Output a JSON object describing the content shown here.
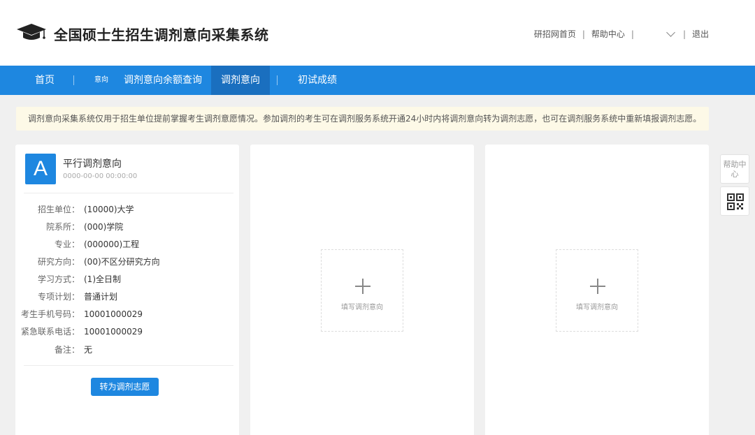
{
  "header": {
    "title": "全国硕士生招生调剂意向采集系统",
    "links": {
      "home": "研招网首页",
      "help": "帮助中心",
      "logout": "退出"
    }
  },
  "nav": {
    "items": [
      {
        "label": "首页"
      },
      {
        "label": "调剂意向余额查询"
      },
      {
        "label": "调剂意向"
      },
      {
        "label": "初试成绩"
      }
    ],
    "small_label": "意向"
  },
  "notice": {
    "text": "调剂意向采集系统仅用于招生单位提前掌握考生调剂意愿情况。参加调剂的考生可在调剂服务系统开通24小时内将调剂意向转为调剂志愿，也可在调剂服务系统中重新填报调剂志愿。"
  },
  "intent_card": {
    "avatar_letter": "A",
    "title": "平行调剂意向",
    "time": "0000-00-00 00:00:00",
    "fields": [
      {
        "label": "招生单位：",
        "value": "(10000)大学"
      },
      {
        "label": "院系所：",
        "value": "(000)学院"
      },
      {
        "label": "专业：",
        "value": "(000000)工程"
      },
      {
        "label": "研究方向：",
        "value": "(00)不区分研究方向"
      },
      {
        "label": "学习方式：",
        "value": "(1)全日制"
      },
      {
        "label": "专项计划：",
        "value": "普通计划"
      },
      {
        "label": "考生手机号码：",
        "value": "10001000029"
      },
      {
        "label": "紧急联系电话：",
        "value": "10001000029"
      },
      {
        "label": "备注：",
        "value": "无"
      }
    ],
    "convert_button": "转为调剂志愿"
  },
  "empty_cards": [
    {
      "add_label": "填写调剂意向"
    },
    {
      "add_label": "填写调剂意向"
    }
  ],
  "side_float": {
    "help_label": "帮助中心",
    "qr_icon": "qrcode-icon"
  },
  "colors": {
    "primary": "#1e87e0",
    "nav_active": "#1a6fbf",
    "notice_bg": "#fdf9e7",
    "page_bg": "#f0f0f0"
  }
}
